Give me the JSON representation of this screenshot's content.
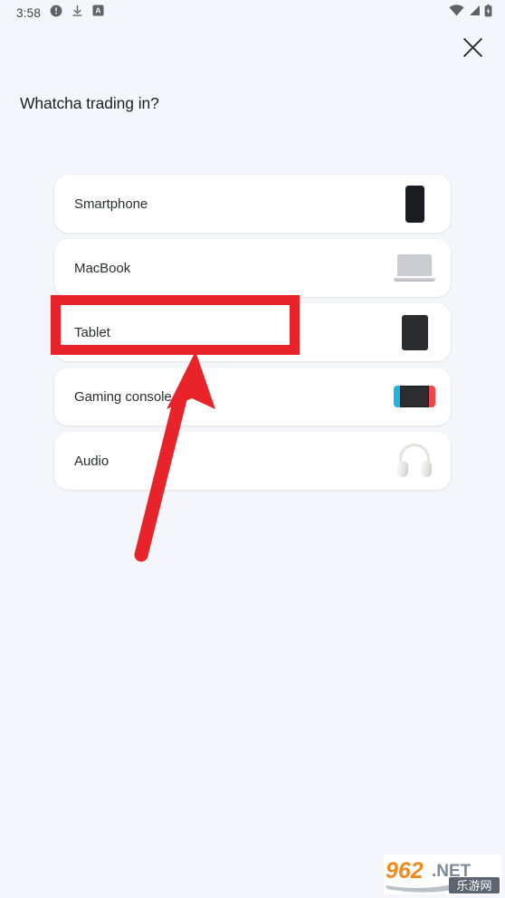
{
  "status_bar": {
    "time": "3:58",
    "left_icons": [
      "info-circle-icon",
      "download-icon",
      "boxed-a-icon"
    ],
    "right_icons": [
      "wifi-icon",
      "cellular-signal-icon",
      "battery-charging-icon"
    ]
  },
  "header": {
    "close_icon": "close-icon",
    "title": "Whatcha trading in?"
  },
  "options": [
    {
      "label": "Smartphone",
      "thumb": "smartphone-thumbnail"
    },
    {
      "label": "MacBook",
      "thumb": "macbook-thumbnail"
    },
    {
      "label": "Tablet",
      "thumb": "tablet-thumbnail"
    },
    {
      "label": "Gaming console",
      "thumb": "gaming-console-thumbnail"
    },
    {
      "label": "Audio",
      "thumb": "headphones-thumbnail"
    }
  ],
  "annotation": {
    "highlight_target": "Tablet",
    "highlight_color": "#e8232a",
    "arrow_color": "#e8232a"
  },
  "watermark": {
    "number": "962",
    "tld": ".NET",
    "cn": "乐游网"
  }
}
